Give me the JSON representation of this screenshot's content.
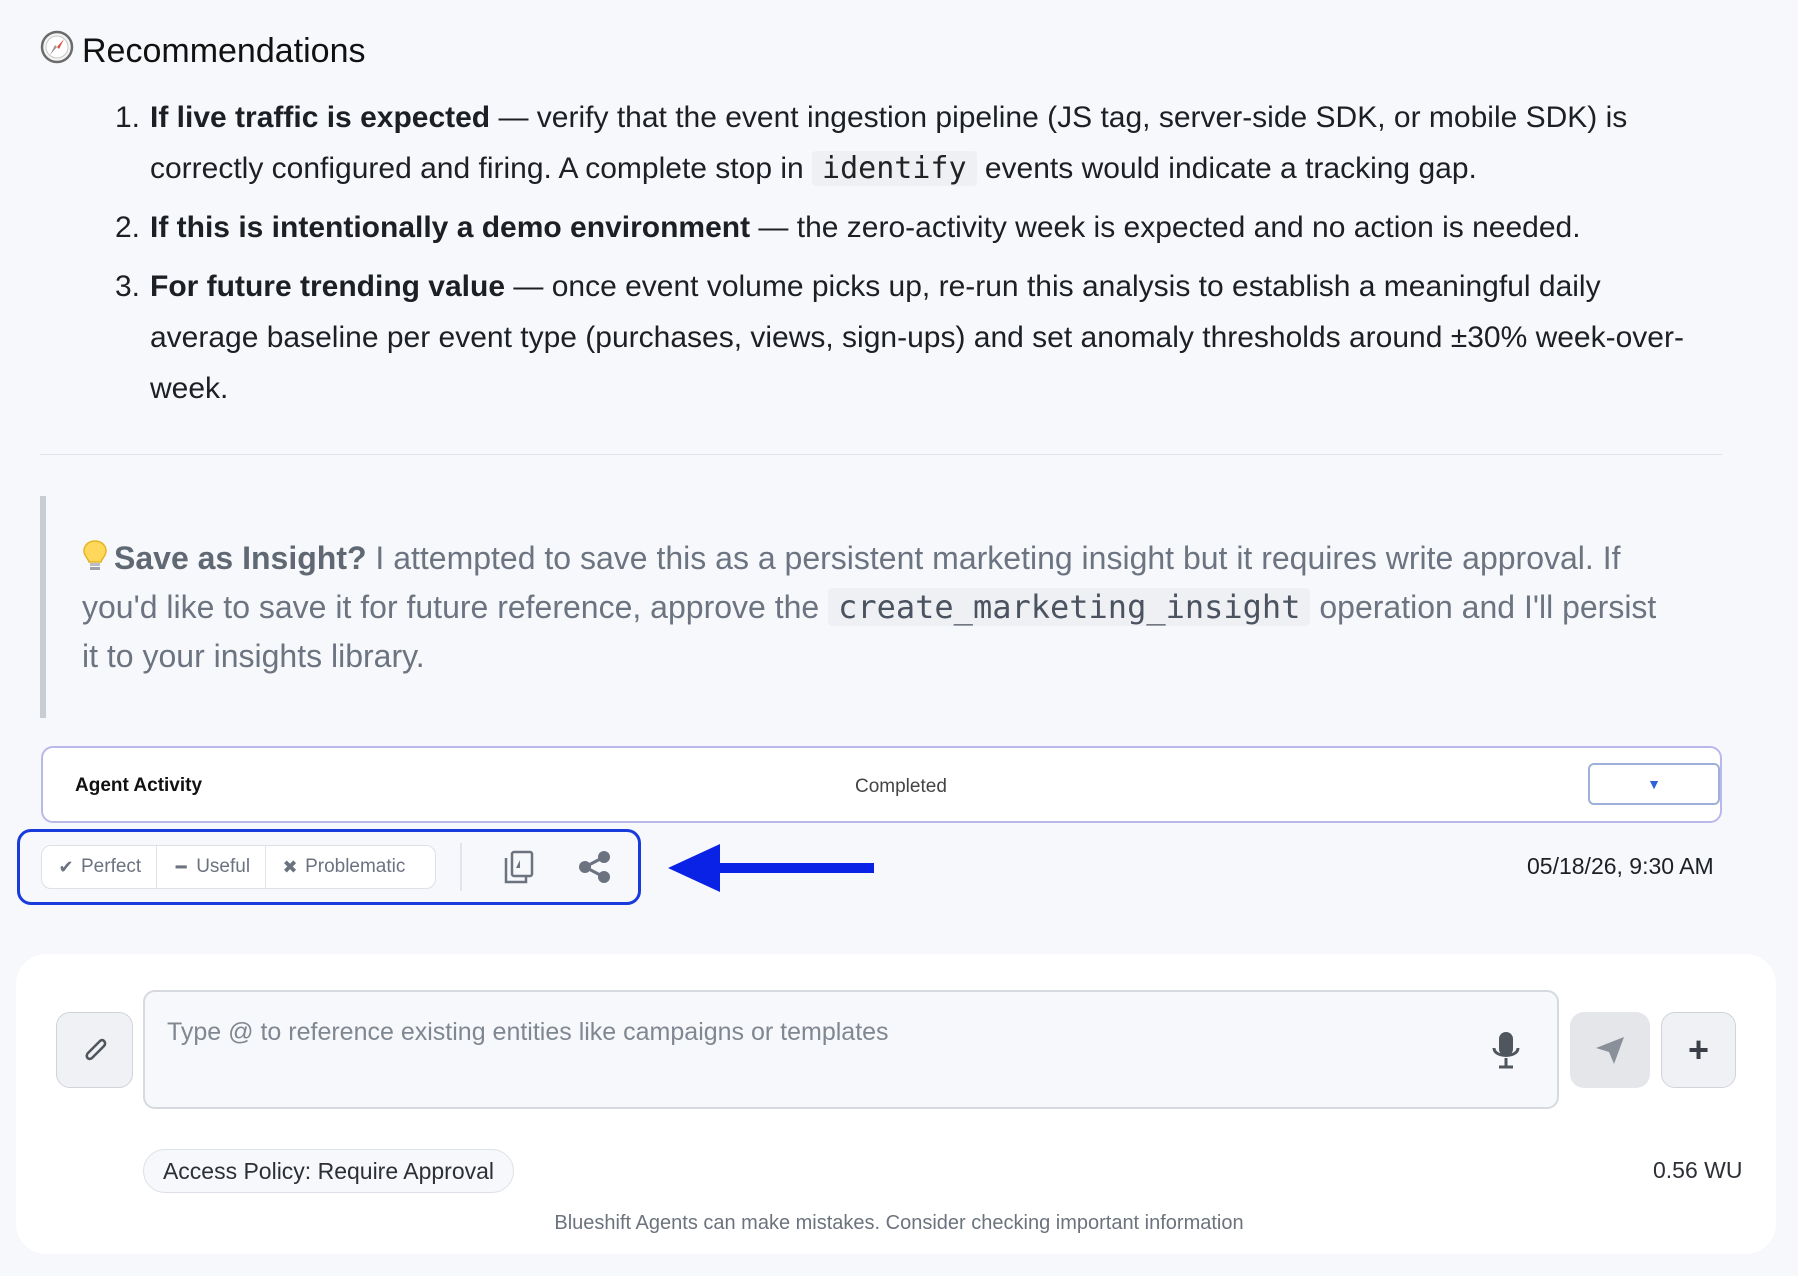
{
  "recommendations": {
    "heading": "Recommendations",
    "icon": "compass-icon",
    "items": [
      {
        "num": "1.",
        "bold": "If live traffic is expected",
        "text_before": " — verify that the event ingestion pipeline (JS tag, server-side SDK, or mobile SDK) is correctly configured and firing. A complete stop in ",
        "code": "identify",
        "text_after": " events would indicate a tracking gap."
      },
      {
        "num": "2.",
        "bold": "If this is intentionally a demo environment",
        "text": " — the zero-activity week is expected and no action is needed."
      },
      {
        "num": "3.",
        "bold": "For future trending value",
        "text": " — once event volume picks up, re-run this analysis to establish a meaningful daily average baseline per event type (purchases, views, sign-ups) and set anomaly thresholds around ±30% week-over-week."
      }
    ]
  },
  "insight": {
    "icon": "lightbulb-icon",
    "bold": "Save as Insight?",
    "text_before": " I attempted to save this as a persistent marketing insight but it requires write approval. If you'd like to save it for future reference, approve the ",
    "code": "create_marketing_insight",
    "text_after": " operation and I'll persist it to your insights library."
  },
  "activity": {
    "title": "Agent Activity",
    "status": "Completed",
    "toggle_icon": "chevron-down-icon"
  },
  "feedback": {
    "perfect": "Perfect",
    "useful": "Useful",
    "problematic": "Problematic"
  },
  "timestamp": "05/18/26, 9:30 AM",
  "composer": {
    "placeholder": "Type @ to reference existing entities like campaigns or templates",
    "policy": "Access Policy: Require Approval",
    "usage": "0.56 WU",
    "disclaimer": "Blueshift Agents can make mistakes. Consider checking important information"
  },
  "colors": {
    "highlight_border": "#1a3bdc",
    "activity_border": "#b9b8ea"
  }
}
